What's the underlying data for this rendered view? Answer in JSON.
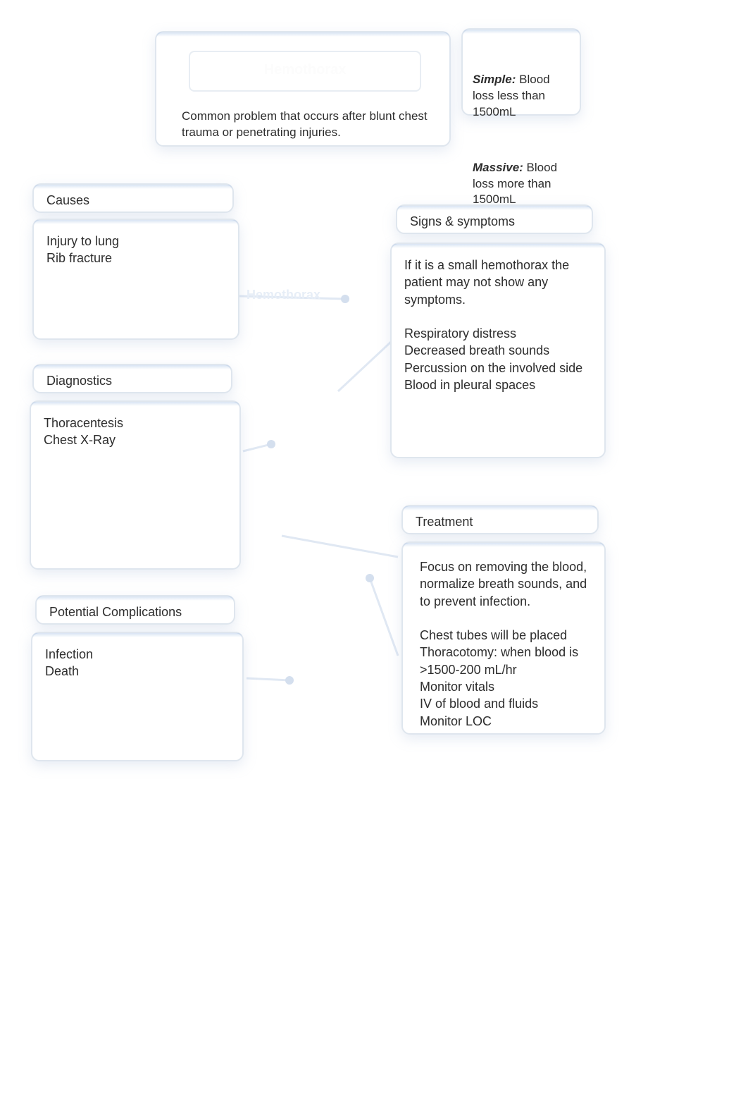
{
  "header": {
    "title": "Hemothorax",
    "description": "Common problem that occurs after blunt chest trauma or penetrating injuries."
  },
  "classification": {
    "simple_label": "Simple:",
    "simple_text": " Blood loss less than 1500mL",
    "massive_label": "Massive:",
    "massive_text": " Blood loss more than 1500mL"
  },
  "central_label": "Hemothorax",
  "sections": {
    "causes": {
      "header": "Causes",
      "body": "Injury to lung\nRib fracture"
    },
    "diagnostics": {
      "header": "Diagnostics",
      "body": "Thoracentesis\nChest X-Ray"
    },
    "complications": {
      "header": "Potential Complications",
      "body": "Infection\nDeath"
    },
    "signs": {
      "header": "Signs & symptoms",
      "body": "If it is a small hemothorax the patient may not show any symptoms.\n\nRespiratory distress\nDecreased breath sounds\nPercussion on the involved side\nBlood in pleural spaces"
    },
    "treatment": {
      "header": "Treatment",
      "body": "Focus on removing the blood, normalize breath sounds, and to prevent infection.\n\nChest tubes will be placed\nThoracotomy: when blood is >1500-200 mL/hr\nMonitor vitals\nIV of blood and fluids\nMonitor LOC"
    }
  }
}
